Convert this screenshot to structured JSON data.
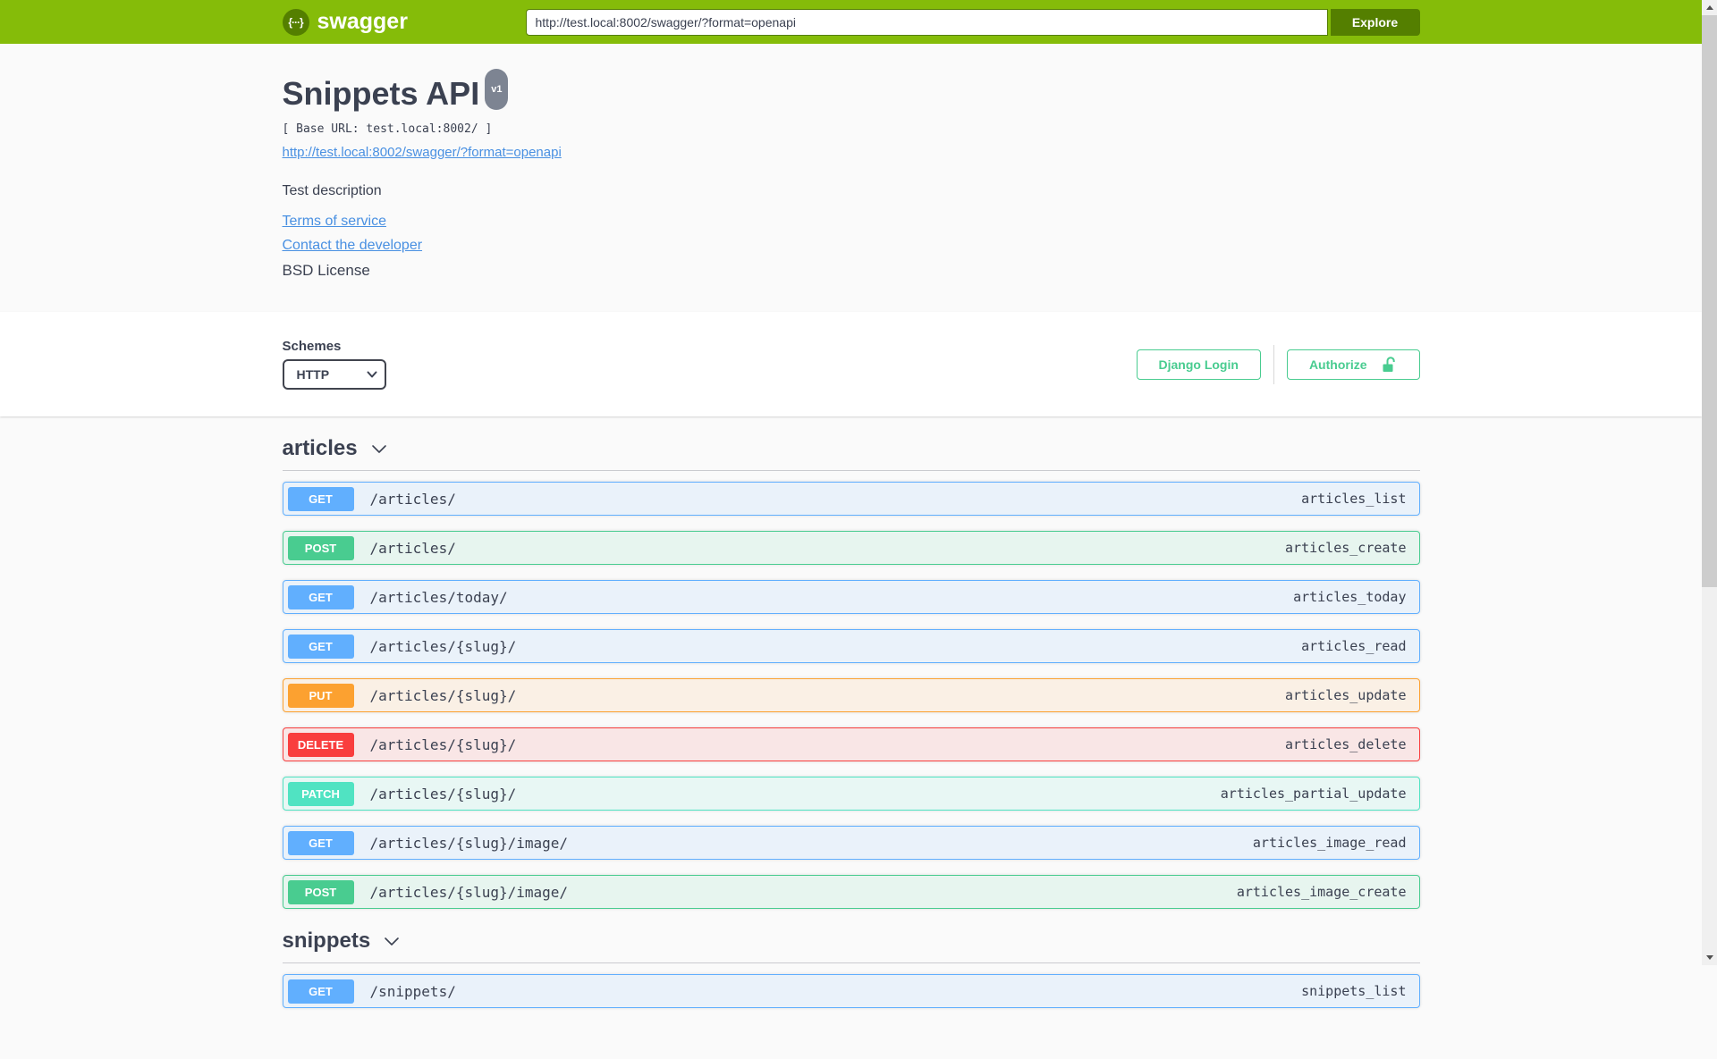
{
  "topbar": {
    "brand": "swagger",
    "logo_glyph": "{···}",
    "url_value": "http://test.local:8002/swagger/?format=openapi",
    "explore_label": "Explore"
  },
  "info": {
    "title": "Snippets API",
    "version_badge": "v1",
    "base_url": "[ Base URL: test.local:8002/ ]",
    "spec_link": "http://test.local:8002/swagger/?format=openapi",
    "description": "Test description",
    "terms_link": "Terms of service",
    "contact_link": "Contact the developer",
    "license": "BSD License"
  },
  "scheme": {
    "label": "Schemes",
    "selected": "HTTP",
    "options": [
      "HTTP"
    ],
    "django_login_label": "Django Login",
    "authorize_label": "Authorize"
  },
  "colors": {
    "topbar_green": "#85bc09",
    "dark_green": "#547f00",
    "accent_green": "#49cc90",
    "link_blue": "#4990e2",
    "text": "#3b4151",
    "method_get": "#61affe",
    "method_post": "#49cc90",
    "method_put": "#fca130",
    "method_delete": "#f93e3e",
    "method_patch": "#50e3c2"
  },
  "sections": [
    {
      "tag": "articles",
      "operations": [
        {
          "method": "GET",
          "path": "/articles/",
          "operation_id": "articles_list"
        },
        {
          "method": "POST",
          "path": "/articles/",
          "operation_id": "articles_create"
        },
        {
          "method": "GET",
          "path": "/articles/today/",
          "operation_id": "articles_today"
        },
        {
          "method": "GET",
          "path": "/articles/{slug}/",
          "operation_id": "articles_read"
        },
        {
          "method": "PUT",
          "path": "/articles/{slug}/",
          "operation_id": "articles_update"
        },
        {
          "method": "DELETE",
          "path": "/articles/{slug}/",
          "operation_id": "articles_delete"
        },
        {
          "method": "PATCH",
          "path": "/articles/{slug}/",
          "operation_id": "articles_partial_update"
        },
        {
          "method": "GET",
          "path": "/articles/{slug}/image/",
          "operation_id": "articles_image_read"
        },
        {
          "method": "POST",
          "path": "/articles/{slug}/image/",
          "operation_id": "articles_image_create"
        }
      ]
    },
    {
      "tag": "snippets",
      "operations": [
        {
          "method": "GET",
          "path": "/snippets/",
          "operation_id": "snippets_list"
        }
      ]
    }
  ]
}
